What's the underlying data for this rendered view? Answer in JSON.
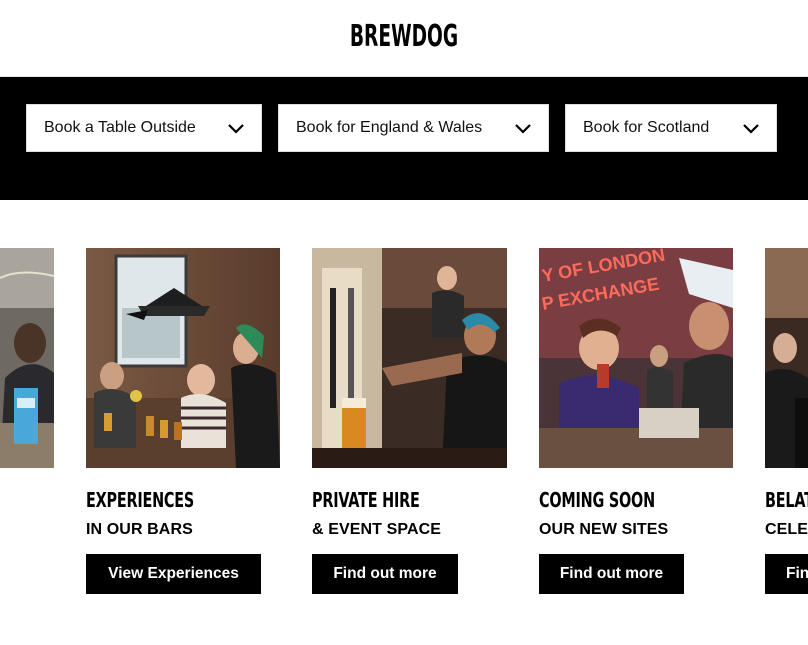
{
  "header": {
    "logo_text": "BREWDOG"
  },
  "booking": {
    "options": [
      {
        "label": "Book a Table Outside"
      },
      {
        "label": "Book for England & Wales"
      },
      {
        "label": "Book for Scotland"
      }
    ]
  },
  "cards": [
    {
      "title": "",
      "subtitle": "",
      "button": ""
    },
    {
      "title": "EXPERIENCES",
      "subtitle": "IN OUR BARS",
      "button": "View Experiences"
    },
    {
      "title": "PRIVATE HIRE",
      "subtitle": "& EVENT SPACE",
      "button": "Find out more"
    },
    {
      "title": "COMING SOON",
      "subtitle": "OUR NEW SITES",
      "button": "Find out more",
      "sign_text": "Y OF LONDON P EXCHANGE"
    },
    {
      "title": "BELAT",
      "subtitle": "CELE",
      "button": "Fin"
    }
  ],
  "colors": {
    "bar_bg": "#000000",
    "button_bg": "#000000",
    "button_text": "#ffffff",
    "neon": "#ff3a2e"
  }
}
